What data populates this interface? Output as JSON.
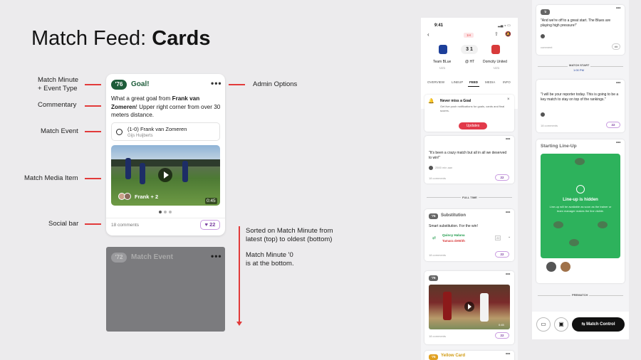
{
  "title": {
    "light": "Match Feed: ",
    "bold": "Cards"
  },
  "labels": {
    "minute": "Match Minute",
    "minute2": "+ Event Type",
    "commentary": "Commentary",
    "event": "Match Event",
    "media": "Match Media Item",
    "social": "Social bar",
    "admin": "Admin Options"
  },
  "notes": {
    "sort1": "Sorted on Match Minute from",
    "sort2": "latest (top) to oldest (bottom)",
    "zero1": "Match Minute '0",
    "zero2": "is at the bottom."
  },
  "goalcard": {
    "minute": "'76",
    "type": "Goal!",
    "text1": "What a great goal from ",
    "name": "Frank van Zomeren",
    "text2": "! Upper right corner from over 30 meters distance.",
    "score": "(1-0)",
    "scorer": "Frank van Zomeren",
    "assist": "Gijs Huijberts",
    "media_people": "Frank + 2",
    "duration": "0:45",
    "comments": "18 comments",
    "likes": "22"
  },
  "eventcard": {
    "minute": "'72",
    "label": "Match Event"
  },
  "phone1": {
    "time": "9:41",
    "live": "1H",
    "home": "Team BLue",
    "home_sub": "U21",
    "away": "Domcity United",
    "away_sub": "U21",
    "score_home": "3",
    "score_away": "1",
    "ht": "@ HT",
    "tabs": [
      "OVERVIEW",
      "LINEUP",
      "FEED",
      "MEDIA",
      "INFO"
    ],
    "notif_title": "Never miss a Goal",
    "notif_text": "Get live push notifications for goals, cards and final scores.",
    "updates_btn": "Updates",
    "c1_text": "\"It's been a crazy match but all in all we deserved to win!\"",
    "c1_author": "2500 min aan",
    "c1_comments": "18 comments",
    "c1_likes": "22",
    "fulltime": "FULL TIME",
    "sub_minute": "'76",
    "sub_title": "Substitution",
    "sub_text": "Smart substitution. For the win!",
    "sub_in": "Quincy Haluna",
    "sub_out": "Tamara deWith",
    "sub_no": "22",
    "sub_comments": "18 comments",
    "sub_likes": "22",
    "m_minute": "'76",
    "m_duration": "0:45",
    "m_comments": "18 comments",
    "m_likes": "22",
    "yc_minute": "'75",
    "yc_title": "Yellow Card"
  },
  "phone2": {
    "c0_minute": "'2",
    "c0_text": "\"And we're off to a great start. The Blues are playing high pressure!\"",
    "c0_comments": "comment",
    "matchstart": "MATCH START",
    "matchstart_time": "1:00 PM",
    "c1_text": "\"I will be your reporter today. This is going to be a key match to stay on top of the rankings.\"",
    "c1_comments": "18 comments",
    "c1_likes": "22",
    "lineup_title": "Starting Line-Up",
    "hidden_title": "Line-up is hidden",
    "hidden_text": "Line-up will be available as soon as the trainer or team manager makes the line visible.",
    "prematch": "PREMATCH",
    "control_btn": "Match Control"
  }
}
